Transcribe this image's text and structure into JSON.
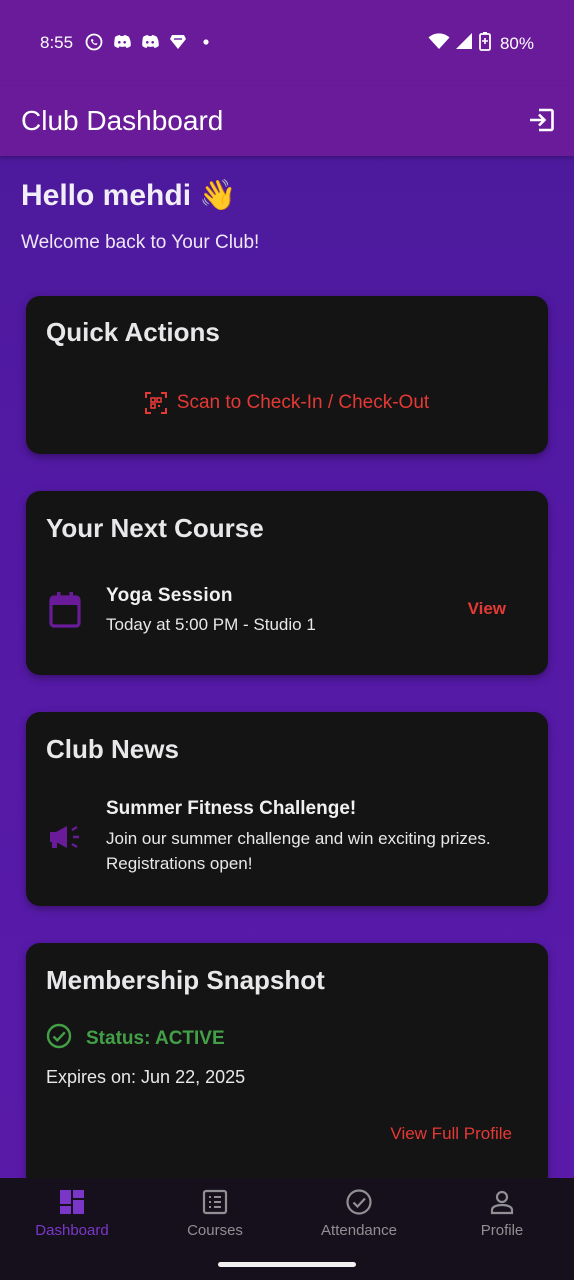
{
  "status_bar": {
    "time": "8:55",
    "battery": "80%"
  },
  "app_bar": {
    "title": "Club Dashboard"
  },
  "greeting": {
    "title": "Hello mehdi 👋",
    "subtitle": "Welcome back to Your Club!"
  },
  "quick_actions": {
    "title": "Quick Actions",
    "scan_label": "Scan to Check-In / Check-Out"
  },
  "next_course": {
    "title": "Your Next Course",
    "name": "Yoga Session",
    "time": "Today at 5:00 PM - Studio 1",
    "view_label": "View"
  },
  "club_news": {
    "title": "Club News",
    "headline": "Summer Fitness Challenge!",
    "body": "Join our summer challenge and win exciting prizes. Registrations open!"
  },
  "membership": {
    "title": "Membership Snapshot",
    "status": "Status: ACTIVE",
    "expires": "Expires on: Jun 22, 2025",
    "profile_link": "View Full Profile"
  },
  "bottom_nav": {
    "items": [
      {
        "label": "Dashboard",
        "icon": "dashboard-icon",
        "active": true
      },
      {
        "label": "Courses",
        "icon": "list-icon",
        "active": false
      },
      {
        "label": "Attendance",
        "icon": "check-circle-icon",
        "active": false
      },
      {
        "label": "Profile",
        "icon": "person-icon",
        "active": false
      }
    ]
  },
  "colors": {
    "accent": "#e53935",
    "primary": "#6a1b9a",
    "success": "#43a047",
    "nav_active": "#7a37c7"
  }
}
